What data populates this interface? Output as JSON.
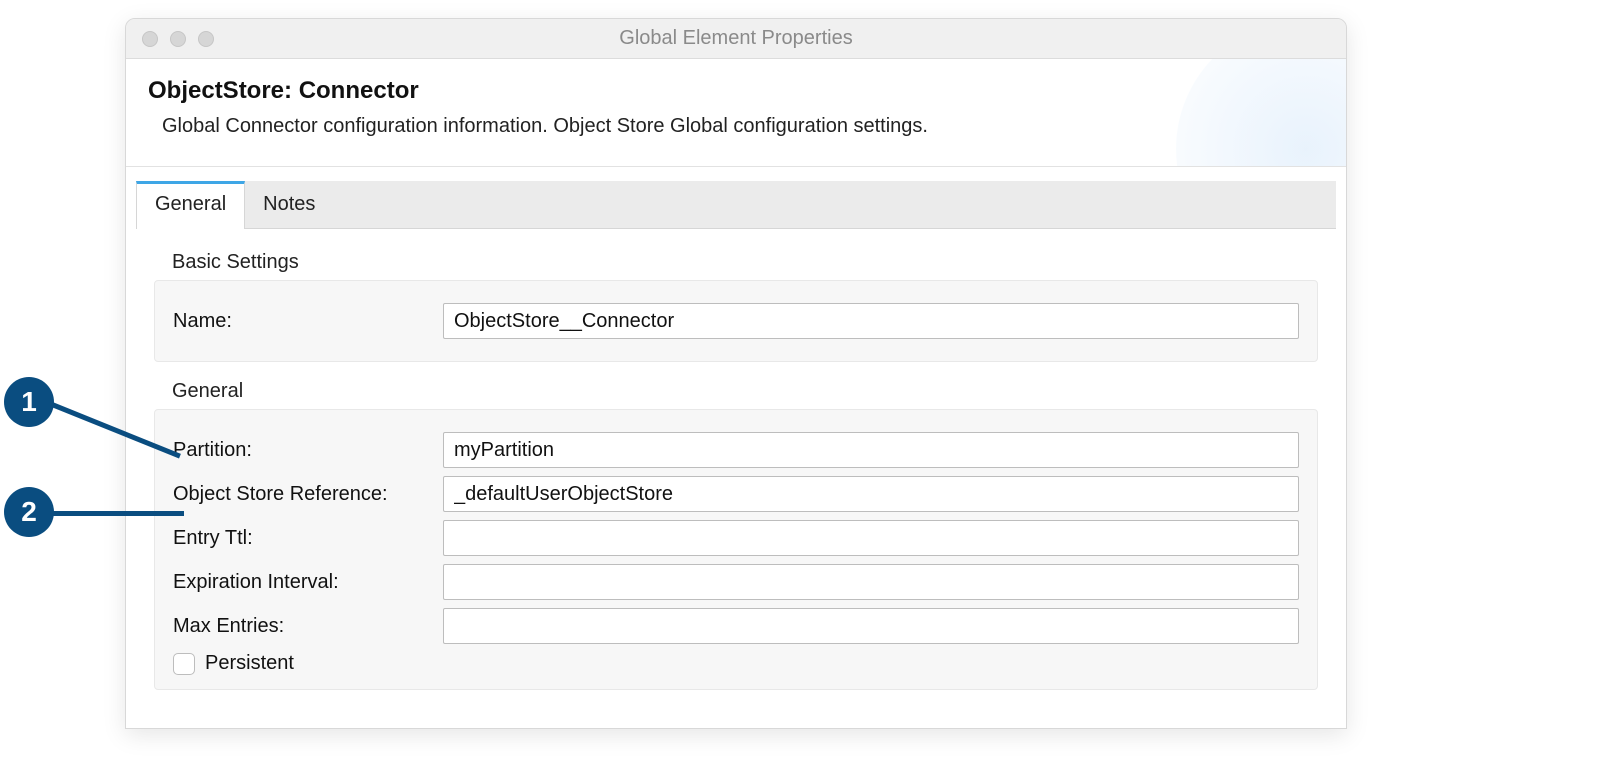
{
  "window": {
    "title": "Global Element Properties"
  },
  "header": {
    "title": "ObjectStore: Connector",
    "description": "Global Connector configuration information. Object Store Global configuration settings."
  },
  "tabs": [
    {
      "label": "General",
      "active": true
    },
    {
      "label": "Notes",
      "active": false
    }
  ],
  "basic_settings": {
    "section_label": "Basic Settings",
    "name_label": "Name:",
    "name_value": "ObjectStore__Connector"
  },
  "general": {
    "section_label": "General",
    "partition_label": "Partition:",
    "partition_value": "myPartition",
    "osref_label": "Object Store Reference:",
    "osref_value": "_defaultUserObjectStore",
    "entryttl_label": "Entry Ttl:",
    "entryttl_value": "",
    "expiration_label": "Expiration Interval:",
    "expiration_value": "",
    "maxentries_label": "Max Entries:",
    "maxentries_value": "",
    "persistent_label": "Persistent",
    "persistent_checked": false
  },
  "callouts": [
    {
      "number": "1"
    },
    {
      "number": "2"
    }
  ]
}
